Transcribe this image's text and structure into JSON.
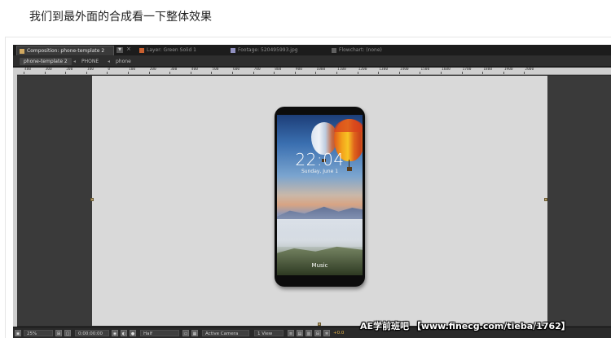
{
  "caption": "我们到最外面的合成看一下整体效果",
  "tabs": [
    {
      "label": "Composition: phone-template 2",
      "swatch": "#d0a860",
      "active": true
    },
    {
      "label": "Layer: Green Solid 1",
      "swatch": "#c86030",
      "active": false
    },
    {
      "label": "Footage: 520495993.jpg",
      "swatch": "#9090c0",
      "active": false
    },
    {
      "label": "Flowchart: (none)",
      "swatch": "#606060",
      "active": false
    }
  ],
  "tab_menu_icon": "▼",
  "tab_close_icon": "×",
  "breadcrumbs": [
    "phone-template 2",
    "PHONE",
    "phone"
  ],
  "ruler_labels": [
    "400",
    "300",
    "200",
    "100",
    "0",
    "100",
    "200",
    "300",
    "400",
    "500",
    "600",
    "700",
    "800",
    "900",
    "1000",
    "1100",
    "1200",
    "1300",
    "1400",
    "1500",
    "1600",
    "1700",
    "1800",
    "1900",
    "2000"
  ],
  "phone_screen": {
    "time": "22:04",
    "date": "Sunday, June 1",
    "music_label": "Music"
  },
  "bottom_bar": {
    "zoom": "25%",
    "timecode": "0:00:00:00",
    "resolution": "Half",
    "camera": "Active Camera",
    "view": "1 View",
    "exposure": "+0.0"
  },
  "watermark": "AE学前班吧 【www.finecg.com/tieba/1762】",
  "colors": {
    "panel_bg": "#2b2b2b",
    "canvas_bg": "#d9d9d9",
    "viewer_bg": "#3a3a3a",
    "exposure": "#e8b64d"
  }
}
